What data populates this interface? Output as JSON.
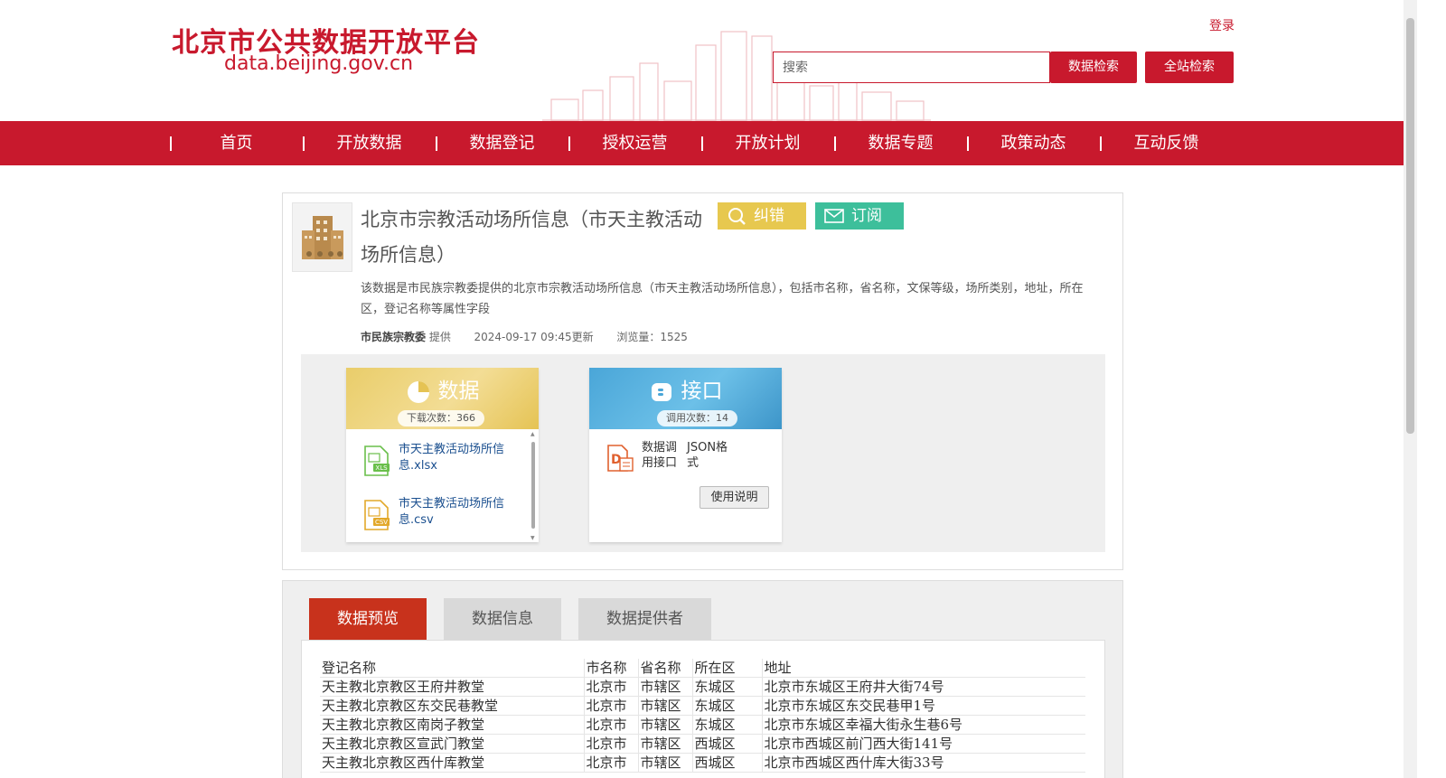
{
  "header": {
    "logo_zh": "北京市公共数据开放平台",
    "logo_en": "data.beijing.gov.cn",
    "login": "登录",
    "search_placeholder": "搜索",
    "data_search": "数据检索",
    "site_search": "全站检索"
  },
  "nav": {
    "items": [
      "首页",
      "开放数据",
      "数据登记",
      "授权运营",
      "开放计划",
      "数据专题",
      "政策动态",
      "互动反馈"
    ]
  },
  "dataset": {
    "title": "北京市宗教活动场所信息（市天主教活动场所信息）",
    "jiucuo": "纠错",
    "dingyue": "订阅",
    "description": "该数据是市民族宗教委提供的北京市宗教活动场所信息（市天主教活动场所信息），包括市名称，省名称，文保等级，场所类别，地址，所在区，登记名称等属性字段",
    "provider": "市民族宗教委",
    "provider_suffix": "提供",
    "updated": "2024-09-17 09:45更新",
    "views": "浏览量：1525"
  },
  "data_panel": {
    "title": "数据",
    "badge": "下载次数：366",
    "files": [
      {
        "name": "市天主教活动场所信息.xlsx",
        "type": "XLS"
      },
      {
        "name": "市天主教活动场所信息.csv",
        "type": "CSV"
      }
    ]
  },
  "api_panel": {
    "title": "接口",
    "badge": "调用次数：14",
    "label1": "数据调用接口",
    "label2": "JSON格式",
    "doc_button": "使用说明"
  },
  "tabs": {
    "preview": "数据预览",
    "info": "数据信息",
    "provider": "数据提供者"
  },
  "table": {
    "headers": [
      "登记名称",
      "市名称",
      "省名称",
      "所在区",
      "地址"
    ],
    "rows": [
      [
        "天主教北京教区王府井教堂",
        "北京市",
        "市辖区",
        "东城区",
        "北京市东城区王府井大街74号"
      ],
      [
        "天主教北京教区东交民巷教堂",
        "北京市",
        "市辖区",
        "东城区",
        "北京市东城区东交民巷甲1号"
      ],
      [
        "天主教北京教区南岗子教堂",
        "北京市",
        "市辖区",
        "东城区",
        "北京市东城区幸福大街永生巷6号"
      ],
      [
        "天主教北京教区宣武门教堂",
        "北京市",
        "市辖区",
        "西城区",
        "北京市西城区前门西大街141号"
      ],
      [
        "天主教北京教区西什库教堂",
        "北京市",
        "市辖区",
        "西城区",
        "北京市西城区西什库大街33号"
      ]
    ]
  },
  "colors": {
    "brand_red": "#c8192d",
    "tab_active": "#c8321c",
    "jiucuo_yellow": "#e7c84f",
    "dingyue_green": "#3dbf9b"
  }
}
